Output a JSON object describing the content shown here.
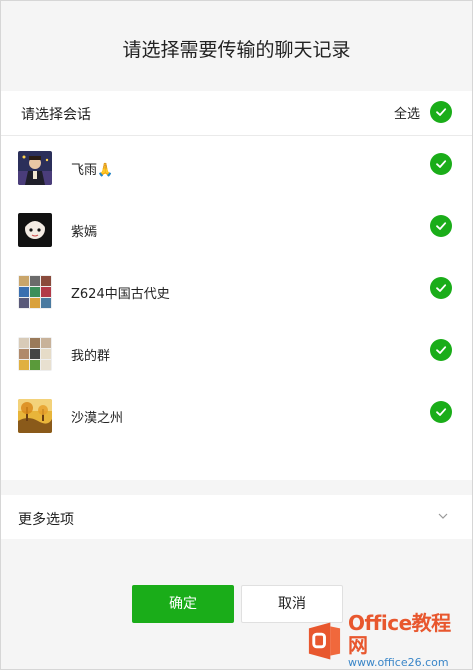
{
  "dialog": {
    "title": "请选择需要传输的聊天记录"
  },
  "header": {
    "label": "请选择会话",
    "select_all_label": "全选",
    "select_all_checked": true
  },
  "conversations": [
    {
      "name": "飞雨🙏",
      "checked": true,
      "avatar_icon": "person-avatar"
    },
    {
      "name": "紫嫣",
      "checked": true,
      "avatar_icon": "cartoon-avatar"
    },
    {
      "name": "Z624中国古代史",
      "checked": true,
      "avatar_icon": "group-grid-avatar"
    },
    {
      "name": "我的群",
      "checked": true,
      "avatar_icon": "group-grid-avatar"
    },
    {
      "name": "沙漠之州",
      "checked": true,
      "avatar_icon": "landscape-avatar"
    }
  ],
  "more_options": {
    "label": "更多选项",
    "icon": "chevron-down-icon"
  },
  "buttons": {
    "ok_label": "确定",
    "cancel_label": "取消"
  },
  "watermark": {
    "main": "Office教程网",
    "sub": "www.office26.com"
  },
  "colors": {
    "accent": "#1aad19",
    "background": "#f5f5f5",
    "watermark_orange": "#e8572e",
    "watermark_blue": "#3a86c8"
  }
}
